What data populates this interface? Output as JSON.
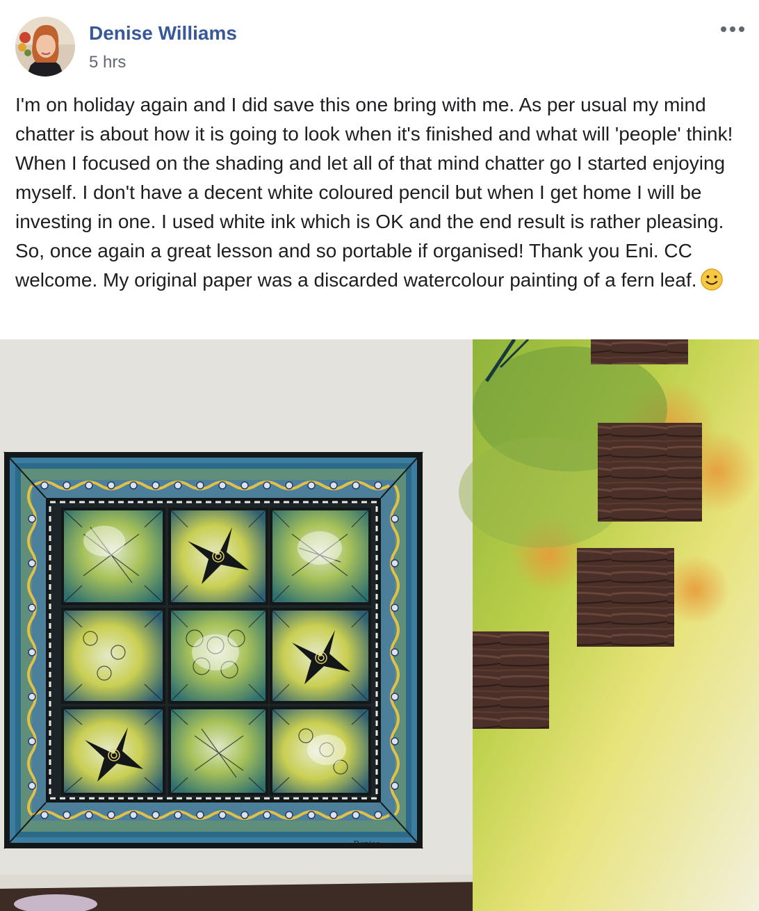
{
  "post": {
    "author": "Denise Williams",
    "timestamp": "5 hrs",
    "text": "I'm on holiday again and I did save this one bring with me. As per usual my mind chatter is about how it is going to look when it's finished and what will 'people' think! When I focused on the shading and let all of that mind chatter go I started enjoying myself. I don't have a decent white coloured pencil but when I get home I will be investing in one. I used white ink which is OK and the end result is rather pleasing. So, once again a great lesson and so portable if organised! Thank you Eni. CC welcome. My original paper was a discarded watercolour painting of a fern leaf.",
    "emoji": "smiley-face",
    "more_icon": "ellipsis-icon",
    "photo": {
      "signature": "Denise"
    }
  },
  "colors": {
    "author_link": "#385898",
    "timestamp": "#616770",
    "body_text": "#1c1e21",
    "more_icon": "#606770",
    "emoji_face": "#f7c843"
  }
}
